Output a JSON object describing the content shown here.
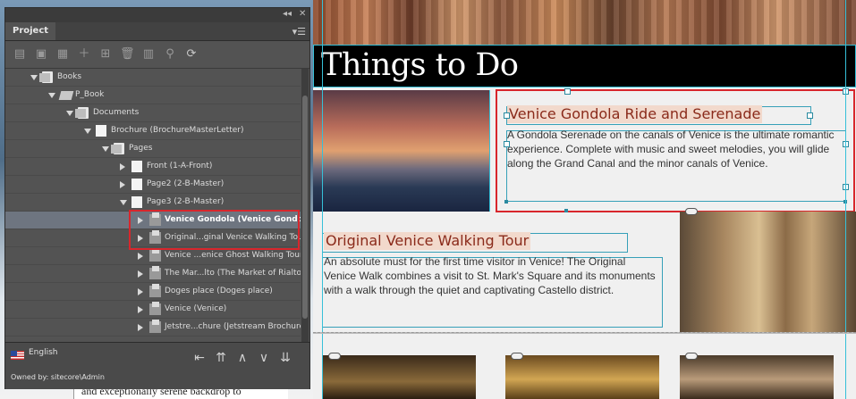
{
  "panel": {
    "tab_label": "Project",
    "topstrip_controls": [
      "◂◂",
      "✕"
    ],
    "menu_icon": "panel-menu-icon",
    "toolbar_icons": [
      "new-item-icon",
      "save-icon",
      "save-all-icon",
      "add-icon",
      "add-child-icon",
      "delete-icon",
      "properties-icon",
      "validate-icon",
      "refresh-icon"
    ],
    "tree": [
      {
        "label": "Books",
        "level": 0,
        "icon": "folder",
        "state": "open"
      },
      {
        "label": "P_Book",
        "level": 1,
        "icon": "book",
        "state": "open"
      },
      {
        "label": "Documents",
        "level": 2,
        "icon": "folder",
        "state": "open"
      },
      {
        "label": "Brochure (BrochureMasterLetter)",
        "level": 3,
        "icon": "page",
        "state": "open"
      },
      {
        "label": "Pages",
        "level": 4,
        "icon": "folder",
        "state": "open"
      },
      {
        "label": "Front (1-A-Front)",
        "level": 5,
        "icon": "page",
        "state": "closed"
      },
      {
        "label": "Page2 (2-B-Master)",
        "level": 5,
        "icon": "page",
        "state": "closed"
      },
      {
        "label": "Page3 (2-B-Master)",
        "level": 5,
        "icon": "page",
        "state": "open"
      },
      {
        "label": "Venice Gondola (Venice Gondola)",
        "level": 6,
        "icon": "item",
        "state": "closed",
        "selected": true
      },
      {
        "label": "Original...ginal Venice Walking Tour)",
        "level": 6,
        "icon": "item",
        "state": "closed"
      },
      {
        "label": "Venice ...enice Ghost Walking Tour)",
        "level": 6,
        "icon": "item",
        "state": "closed"
      },
      {
        "label": "The Mar...lto (The Market of Rialto)",
        "level": 6,
        "icon": "item",
        "state": "closed"
      },
      {
        "label": "Doges place (Doges place)",
        "level": 6,
        "icon": "item",
        "state": "closed"
      },
      {
        "label": "Venice (Venice)",
        "level": 6,
        "icon": "item",
        "state": "closed"
      },
      {
        "label": "Jetstre...chure (Jetstream Brochure)",
        "level": 6,
        "icon": "item",
        "state": "closed"
      }
    ],
    "footer": {
      "language": "English",
      "owner": "Owned by: sitecore\\Admin",
      "nav_buttons": [
        {
          "name": "move-to-icon",
          "glyph": "⇤"
        },
        {
          "name": "move-first-icon",
          "glyph": "⇈"
        },
        {
          "name": "move-up-icon",
          "glyph": "∧"
        },
        {
          "name": "move-down-icon",
          "glyph": "∨"
        },
        {
          "name": "move-last-icon",
          "glyph": "⇊"
        }
      ]
    }
  },
  "document": {
    "title": "Things to Do",
    "gondola": {
      "heading": "Venice Gondola Ride and Serenade",
      "body": "A Gondola Serenade on the canals of Venice is the ultimate romantic experience. Complete with music and sweet melodies, you will glide along the Grand Canal and the minor canals of Venice."
    },
    "walking": {
      "heading": "Original Venice Walking Tour",
      "body": "An absolute must for the first time visitor in Venice! The Original Venice Walk combines a visit to St. Mark's Square and its monuments with a walk through the quiet and captivating Castello district."
    },
    "bottom_text": "and exceptionally serene backdrop to"
  },
  "colors": {
    "selection_red": "#d8262c",
    "guide_cyan": "#36c0d8",
    "heading_text": "#8a2a1a",
    "heading_bg": "#f2d9cc"
  }
}
